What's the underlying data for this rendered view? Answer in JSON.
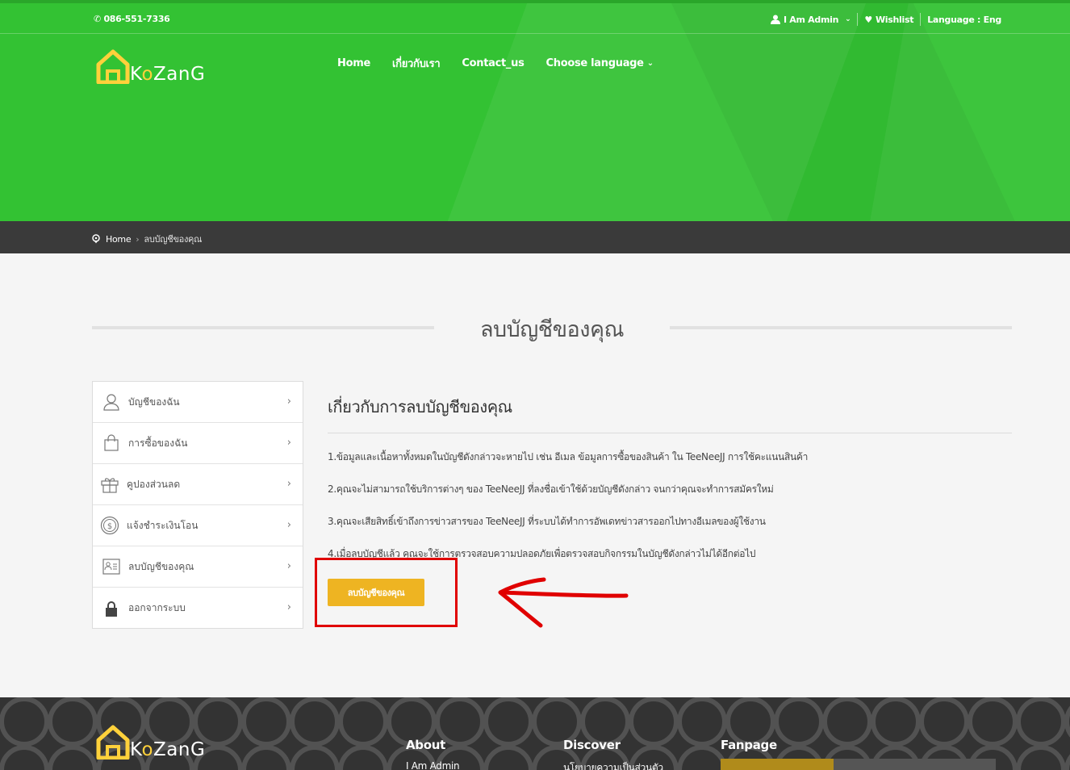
{
  "topbar": {
    "phone": "086-551-7336",
    "user": "I Am Admin",
    "wishlist": "Wishlist",
    "language": "Language : Eng"
  },
  "logo": {
    "text_a": "K",
    "text_o": "o",
    "text_b": "ZanG"
  },
  "nav": {
    "home": "Home",
    "about": "เกี่ยวกับเรา",
    "contact": "Contact_us",
    "choose_language": "Choose language"
  },
  "breadcrumb": {
    "home": "Home",
    "separator": "›",
    "current": "ลบบัญชีของคุณ"
  },
  "page_title": "ลบบัญชีของคุณ",
  "sidebar": {
    "items": [
      {
        "label": "บัญชีของฉัน",
        "icon": "user-icon"
      },
      {
        "label": "การซื้อของฉัน",
        "icon": "shopping-bag-icon"
      },
      {
        "label": "คูปองส่วนลด",
        "icon": "gift-icon"
      },
      {
        "label": "แจ้งชำระเงินโอน",
        "icon": "coin-icon"
      },
      {
        "label": "ลบบัญชีของคุณ",
        "icon": "id-card-icon"
      },
      {
        "label": "ออกจากระบบ",
        "icon": "lock-icon"
      }
    ],
    "chevron": "›"
  },
  "content": {
    "heading": "เกี่ยวกับการลบบัญชีของคุณ",
    "points": [
      "1.ข้อมูลและเนื้อหาทั้งหมดในบัญชีดังกล่าวจะหายไป เช่น อีเมล ข้อมูลการซื้อของสินค้า ใน TeeNeeJJ การใช้คะแนนสินค้า",
      "2.คุณจะไม่สามารถใช้บริการต่างๆ ของ TeeNeeJJ ที่ลงชื่อเข้าใช้ด้วยบัญชีดังกล่าว จนกว่าคุณจะทำการสมัครใหม่",
      "3.คุณจะเสียสิทธิ์เข้าถึงการข่าวสารของ TeeNeeJJ ที่ระบบได้ทำการอัพเดทข่าวสารออกไปทางอีเมลของผู้ใช้งาน",
      "4.เมื่อลบบัญชีแล้ว คุณจะใช้การตรวจสอบความปลอดภัยเพื่อตรวจสอบกิจกรรมในบัญชีดังกล่าวไม่ได้อีกต่อไป"
    ],
    "delete_button": "ลบบัญชีของคุณ"
  },
  "footer": {
    "about": "About",
    "about_sub": "I Am Admin",
    "discover": "Discover",
    "discover_sub": "นโยบายความเป็นส่วนตัว",
    "fanpage": "Fanpage"
  },
  "colors": {
    "hero_green": "#33c233",
    "button_yellow": "#eeb422",
    "annotation_red": "#e00000",
    "footer_dark": "#333333"
  }
}
